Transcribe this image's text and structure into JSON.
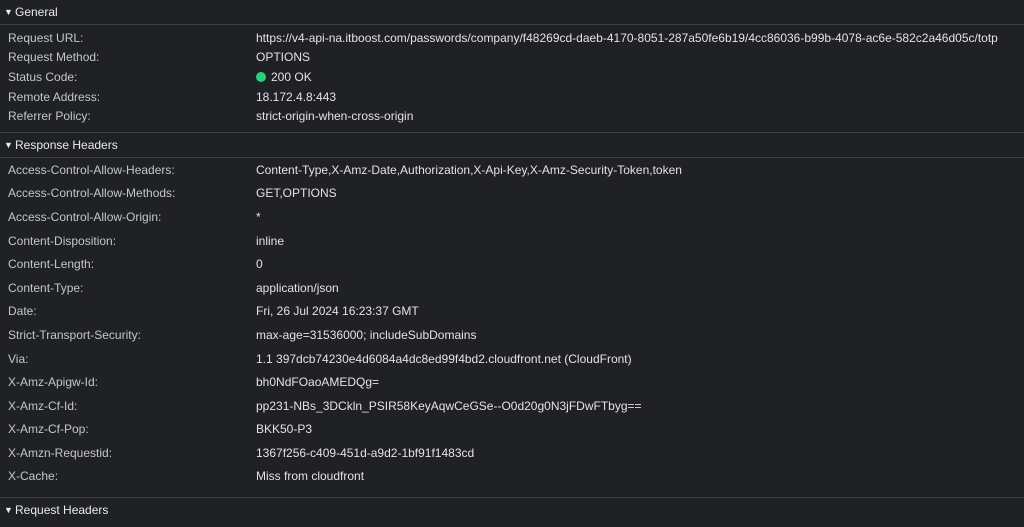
{
  "colors": {
    "background": "#202124",
    "divider": "#3c4043",
    "status_ok": "#2bd17a"
  },
  "sections": {
    "general": {
      "title": "General",
      "expanded": true,
      "rows": [
        {
          "key": "Request URL:",
          "value": "https://v4-api-na.itboost.com/passwords/company/f48269cd-daeb-4170-8051-287a50fe6b19/4cc86036-b99b-4078-ac6e-582c2a46d05c/totp"
        },
        {
          "key": "Request Method:",
          "value": "OPTIONS"
        },
        {
          "key": "Status Code:",
          "value": "200 OK",
          "icon": "status-dot-icon"
        },
        {
          "key": "Remote Address:",
          "value": "18.172.4.8:443"
        },
        {
          "key": "Referrer Policy:",
          "value": "strict-origin-when-cross-origin"
        }
      ]
    },
    "response_headers": {
      "title": "Response Headers",
      "expanded": true,
      "rows": [
        {
          "key": "Access-Control-Allow-Headers:",
          "value": "Content-Type,X-Amz-Date,Authorization,X-Api-Key,X-Amz-Security-Token,token"
        },
        {
          "key": "Access-Control-Allow-Methods:",
          "value": "GET,OPTIONS"
        },
        {
          "key": "Access-Control-Allow-Origin:",
          "value": "*"
        },
        {
          "key": "Content-Disposition:",
          "value": "inline"
        },
        {
          "key": "Content-Length:",
          "value": "0"
        },
        {
          "key": "Content-Type:",
          "value": "application/json"
        },
        {
          "key": "Date:",
          "value": "Fri, 26 Jul 2024 16:23:37 GMT"
        },
        {
          "key": "Strict-Transport-Security:",
          "value": "max-age=31536000; includeSubDomains"
        },
        {
          "key": "Via:",
          "value": "1.1 397dcb74230e4d6084a4dc8ed99f4bd2.cloudfront.net (CloudFront)"
        },
        {
          "key": "X-Amz-Apigw-Id:",
          "value": "bh0NdFOaoAMEDQg="
        },
        {
          "key": "X-Amz-Cf-Id:",
          "value": "pp231-NBs_3DCkln_PSIR58KeyAqwCeGSe--O0d20g0N3jFDwFTbyg=="
        },
        {
          "key": "X-Amz-Cf-Pop:",
          "value": "BKK50-P3"
        },
        {
          "key": "X-Amzn-Requestid:",
          "value": "1367f256-c409-451d-a9d2-1bf91f1483cd"
        },
        {
          "key": "X-Cache:",
          "value": "Miss from cloudfront"
        }
      ]
    },
    "request_headers": {
      "title": "Request Headers",
      "expanded": true
    }
  }
}
